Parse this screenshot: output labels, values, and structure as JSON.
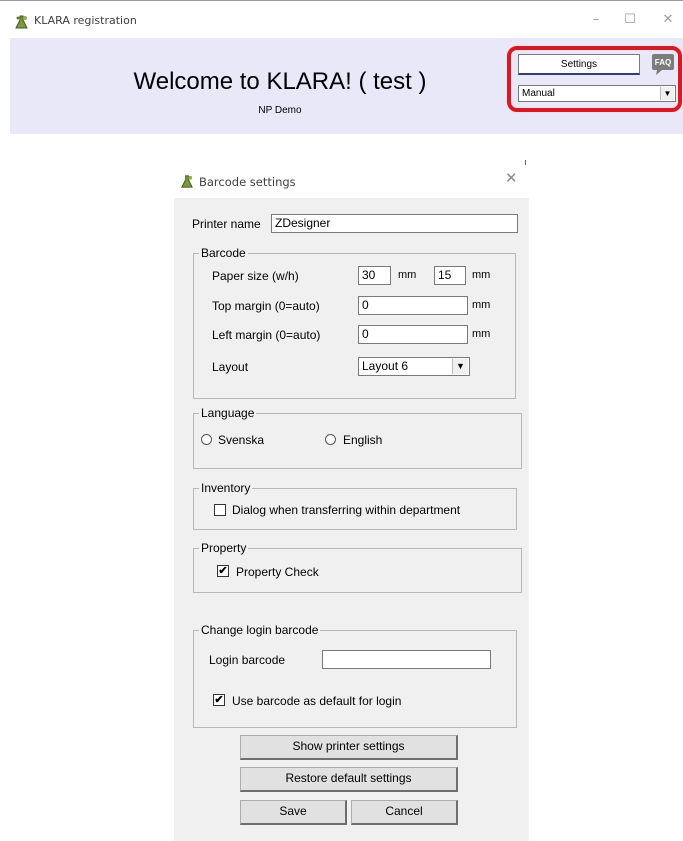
{
  "window": {
    "title": "KLARA registration",
    "controls": {
      "minimize": "–",
      "maximize": "☐",
      "close": "✕"
    }
  },
  "header": {
    "welcome": "Welcome to KLARA! ( test )",
    "subtitle": "NP Demo",
    "settings_button": "Settings",
    "faq_label": "FAQ",
    "mode_select": "Manual",
    "highlight_color": "#e0161c",
    "background_color": "#e8e8f8"
  },
  "dialog": {
    "title": "Barcode settings",
    "close": "✕",
    "printer_name_label": "Printer name",
    "printer_name_value": "ZDesigner",
    "barcode": {
      "legend": "Barcode",
      "paper_size_label": "Paper size (w/h)",
      "paper_width": "30",
      "paper_height": "15",
      "unit": "mm",
      "top_margin_label": "Top margin (0=auto)",
      "top_margin_value": "0",
      "left_margin_label": "Left margin (0=auto)",
      "left_margin_value": "0",
      "layout_label": "Layout",
      "layout_value": "Layout 6"
    },
    "language": {
      "legend": "Language",
      "option_svenska": "Svenska",
      "option_english": "English"
    },
    "inventory": {
      "legend": "Inventory",
      "dialog_checkbox_label": "Dialog when transferring within department",
      "dialog_checked": false
    },
    "property": {
      "legend": "Property",
      "check_label": "Property Check",
      "check_checked": true
    },
    "login": {
      "legend": "Change login barcode",
      "login_barcode_label": "Login barcode",
      "login_barcode_value": "",
      "use_default_label": "Use barcode as default for login",
      "use_default_checked": true
    },
    "buttons": {
      "show_printer_settings": "Show printer settings",
      "restore_defaults": "Restore default settings",
      "save": "Save",
      "cancel": "Cancel"
    },
    "check_mark": "✔"
  }
}
